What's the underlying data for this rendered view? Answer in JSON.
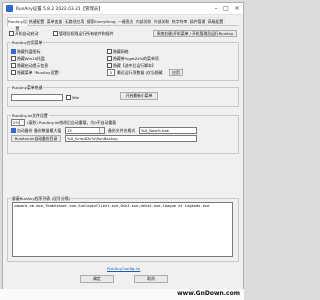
{
  "window": {
    "title": "RunAny设置 5.8.2 2022.03.21【管理员】",
    "minimize_glyph": "–",
    "maximize_glyph": "□",
    "close_glyph": "×"
  },
  "tabs": [
    "RunAny设置",
    "热键配置",
    "菜单变量",
    "无路径应用",
    "搜索Everything",
    "一键直达",
    "内部关联",
    "外部关联",
    "热字符串",
    "插件管理",
    "高级配置"
  ],
  "top_options": {
    "autostart": "开机自动启动",
    "admin_start": "管理员权限运行所有软件和插件",
    "setup_btn": "系统右键/开机菜单 / 开机管理员运行RunAny"
  },
  "app_usage": {
    "title": "RunAny应用菜单",
    "hide_icon": "隐藏托盘图标",
    "hide_tray_msg": "隐藏Win10托盘",
    "hide_reload_tip": "隐藏启动提示信息",
    "hide_run_tip": "隐藏菜单 \"RunAny设置\"",
    "hide_network": "隐藏网络",
    "hide_hotkey_menu": "隐藏带%getZz%的菜单项",
    "hide_script": "隐藏【选中后运行脚本】",
    "recent_label": "最近运行项数量 (仅当隐藏",
    "recent_value": "3",
    "apply_btn": "应用"
  },
  "menu_key": {
    "title": "RunAny菜单热键",
    "value": "",
    "win_label": "Win",
    "open_btn": "开启最新小菜单"
  },
  "ini": {
    "title": "RunAny.ini文件设置",
    "timeout_value": "2500",
    "timeout_label": "(毫秒) RunAny.ini修改后自动重载，为0不自动重载",
    "auto_backup": "自动备份",
    "backup_count_label": "备份数量最大值",
    "backup_count": "15",
    "backup_name_label": "备份文件名格式",
    "backup_name": "%A_Now%.bak",
    "backup_folder_btn": "RunAny.ini自动备份目录",
    "backup_folder": "%A_ScriptDir%\\RunBackup"
  },
  "block": {
    "title": "屏蔽RunAny程序列表 (逗号分隔)",
    "content": "cmware-vm.exe,TeamViewer.exe,SunloginClient.exe,Dsk3.exe,dota2.exe,League of Legends.exe"
  },
  "footer": {
    "config_link": "RunAnyConfig.ini",
    "ok_btn": "确定",
    "cancel_btn": "取消"
  },
  "watermark": "www.GnDown.com",
  "colors": {
    "link": "#1a5fb4",
    "accent": "#2c6bd6",
    "window_bg": "#f0f0f0"
  }
}
